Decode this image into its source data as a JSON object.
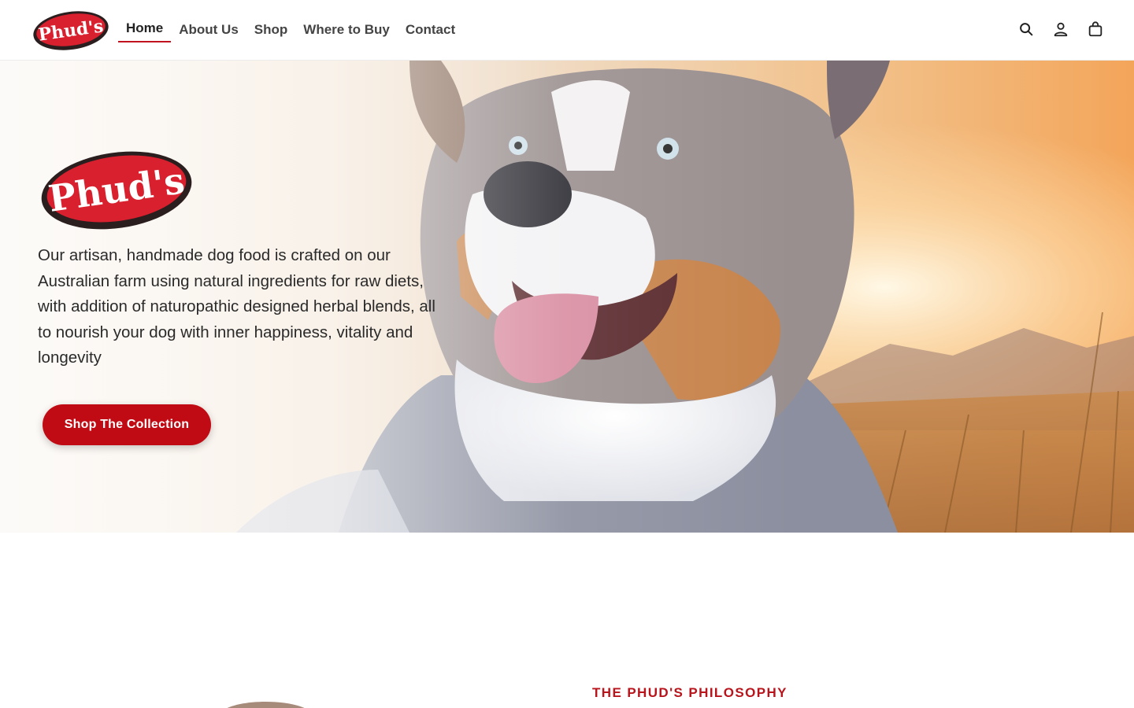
{
  "brand": {
    "logo_text": "Phud's",
    "colors": {
      "accent": "#c10b14",
      "logo_red": "#d8202e",
      "logo_dark": "#2a1e1e"
    }
  },
  "nav": {
    "items": [
      {
        "label": "Home",
        "active": true
      },
      {
        "label": "About Us",
        "active": false
      },
      {
        "label": "Shop",
        "active": false
      },
      {
        "label": "Where to Buy",
        "active": false
      },
      {
        "label": "Contact",
        "active": false
      }
    ]
  },
  "header_icons": [
    "search-icon",
    "account-icon",
    "cart-icon"
  ],
  "hero": {
    "description": "Our artisan, handmade dog food is crafted on our Australian farm using natural ingredients for raw diets, with addition of naturopathic designed herbal blends, all to nourish your dog with inner happiness, vitality and longevity",
    "cta_label": "Shop The Collection"
  },
  "section": {
    "heading": "THE PHUD'S PHILOSOPHY"
  }
}
